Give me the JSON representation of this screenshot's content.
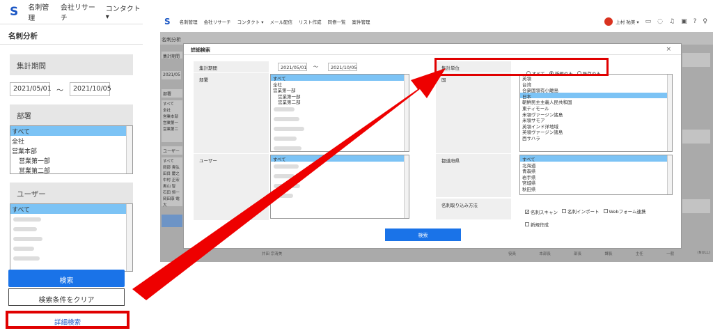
{
  "left": {
    "brand": "S",
    "nav": [
      "名刺管理",
      "会社リサーチ",
      "コンタクト ▾"
    ],
    "page_title": "名刺分析",
    "period_label": "集計期間",
    "date_from": "2021/05/01",
    "tilde": "～",
    "date_to": "2021/10/05",
    "dept_label": "部署",
    "dept_items": [
      {
        "label": "すべて",
        "selected": true,
        "indent": false
      },
      {
        "label": "全社",
        "selected": false,
        "indent": false
      },
      {
        "label": "営業本部",
        "selected": false,
        "indent": false
      },
      {
        "label": "営業第一部",
        "selected": false,
        "indent": true
      },
      {
        "label": "営業第二部",
        "selected": false,
        "indent": true
      }
    ],
    "user_label": "ユーザー",
    "user_first": "すべて",
    "search_button": "検索",
    "clear_button": "検索条件をクリア",
    "detail_button": "詳細検索"
  },
  "right": {
    "brand": "S",
    "nav": [
      "名刺管理",
      "会社リサーチ",
      "コンタクト ▾",
      "メール配信",
      "リスト作成",
      "同僚一覧",
      "案件管理"
    ],
    "user_name": "上村 祐美 ▾",
    "page_title": "名刺分析",
    "background": {
      "period_label": "集計期間",
      "date_from": "2021/05",
      "dept_label": "部署",
      "dept_items": [
        "すべて",
        "全社",
        "営業本部",
        "営業第一",
        "営業第二"
      ],
      "user_label": "ユーザー",
      "user_items": [
        "すべて",
        "岡部 貴弘",
        "田目 慶之",
        "中村 正宏",
        "奥山 智",
        "石田 恒一",
        "岡田康 電大"
      ],
      "bottom_name": "井田 宗清美",
      "bottom_cols": [
        "役員",
        "本部長",
        "部長",
        "課長",
        "主任",
        "一般",
        "(NULL)"
      ]
    },
    "modal": {
      "title": "詳細検索",
      "close": "×",
      "period_label": "集計期間",
      "date_from": "2021/05/01",
      "tilde": "～",
      "date_to": "2021/10/05",
      "dept_label": "部署",
      "dept_items": [
        {
          "label": "すべて",
          "selected": true,
          "indent": false
        },
        {
          "label": "全社",
          "selected": false,
          "indent": false
        },
        {
          "label": "営業第一部",
          "selected": false,
          "indent": false
        },
        {
          "label": "営業第一部",
          "selected": false,
          "indent": true
        },
        {
          "label": "営業第二部",
          "selected": false,
          "indent": true
        }
      ],
      "user_label": "ユーザー",
      "user_first": "すべて",
      "unit_label": "集計単位",
      "unit_options": [
        {
          "label": "すべて",
          "checked": false
        },
        {
          "label": "新規のみ",
          "checked": true
        },
        {
          "label": "既存のみ",
          "checked": false
        }
      ],
      "country_label": "国",
      "country_items": [
        {
          "label": "英領",
          "selected": false
        },
        {
          "label": "台湾",
          "selected": false
        },
        {
          "label": "合衆国領有小離島",
          "selected": false
        },
        {
          "label": "日本",
          "selected": true
        },
        {
          "label": "朝鮮民主主義人民共和国",
          "selected": false
        },
        {
          "label": "東ティモール",
          "selected": false
        },
        {
          "label": "米領ヴァージン諸島",
          "selected": false
        },
        {
          "label": "米領サモア",
          "selected": false
        },
        {
          "label": "英領インド洋地域",
          "selected": false
        },
        {
          "label": "英領ヴァージン諸島",
          "selected": false
        },
        {
          "label": "西サハラ",
          "selected": false
        }
      ],
      "pref_label": "都道府県",
      "pref_items": [
        {
          "label": "すべて",
          "selected": true
        },
        {
          "label": "北海道",
          "selected": false
        },
        {
          "label": "青森県",
          "selected": false
        },
        {
          "label": "岩手県",
          "selected": false
        },
        {
          "label": "宮城県",
          "selected": false
        },
        {
          "label": "秋田県",
          "selected": false
        }
      ],
      "import_label": "名刺取り込み方法",
      "import_options": [
        {
          "label": "名刺スキャン",
          "checked": true
        },
        {
          "label": "名刺インポート",
          "checked": false
        },
        {
          "label": "Webフォーム連携",
          "checked": false
        },
        {
          "label": "新規作成",
          "checked": false
        }
      ],
      "search_button": "検索"
    }
  },
  "colors": {
    "accent_blue": "#1a73e8",
    "selection": "#7cc3f5",
    "highlight_red": "#e00000"
  }
}
